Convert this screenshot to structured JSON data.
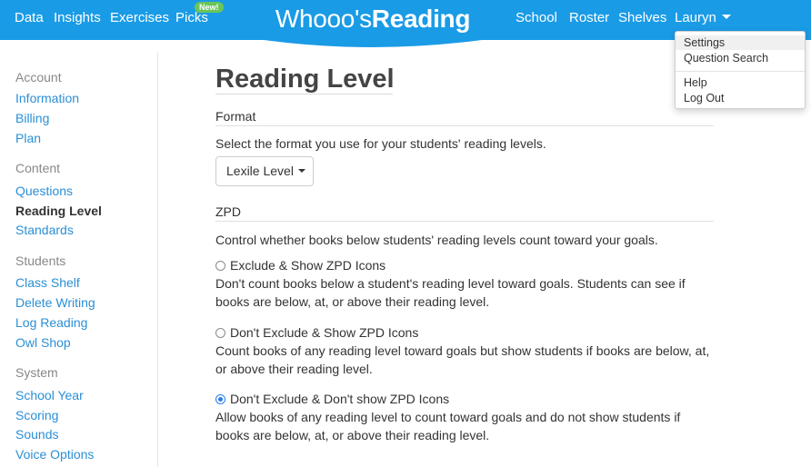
{
  "nav": {
    "left": [
      "Data",
      "Insights",
      "Exercises",
      "Picks"
    ],
    "new_badge": "New!",
    "logo_part1": "Whooo's",
    "logo_part2": "Reading",
    "right": [
      "School",
      "Roster",
      "Shelves"
    ],
    "user": "Lauryn"
  },
  "dropdown": {
    "items": [
      "Settings",
      "Question Search",
      "Help",
      "Log Out"
    ]
  },
  "sidebar": {
    "sections": [
      {
        "heading": "Account",
        "items": [
          "Information",
          "Billing",
          "Plan"
        ]
      },
      {
        "heading": "Content",
        "items": [
          "Questions",
          "Reading Level",
          "Standards"
        ]
      },
      {
        "heading": "Students",
        "items": [
          "Class Shelf",
          "Delete Writing",
          "Log Reading",
          "Owl Shop"
        ]
      },
      {
        "heading": "System",
        "items": [
          "School Year",
          "Scoring",
          "Sounds",
          "Voice Options"
        ]
      }
    ],
    "active": "Reading Level"
  },
  "main": {
    "title": "Reading Level",
    "format": {
      "heading": "Format",
      "description": "Select the format you use for your students' reading levels.",
      "selected": "Lexile Level"
    },
    "zpd": {
      "heading": "ZPD",
      "description": "Control whether books below students' reading levels count toward your goals.",
      "options": [
        {
          "label": "Exclude & Show ZPD Icons",
          "description": "Don't count books below a student's reading level toward goals. Students can see if books are below, at, or above their reading level.",
          "checked": false
        },
        {
          "label": "Don't Exclude & Show ZPD Icons",
          "description": "Count books of any reading level toward goals but show students if books are below, at, or above their reading level.",
          "checked": false
        },
        {
          "label": "Don't Exclude & Don't show ZPD Icons",
          "description": "Allow books of any reading level to count toward goals and do not show students if books are below, at, or above their reading level.",
          "checked": true
        }
      ]
    }
  },
  "colors": {
    "brand_blue": "#1a9be6",
    "link_blue": "#2a8fd6",
    "badge_green": "#6ac55a",
    "radio_blue": "#2b7de9"
  }
}
